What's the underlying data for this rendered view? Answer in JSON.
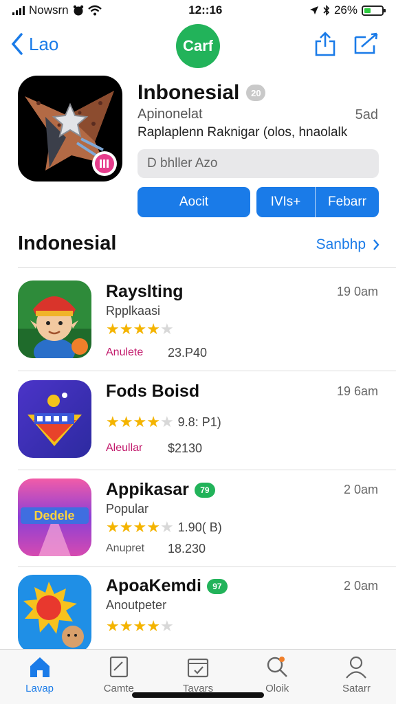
{
  "status_bar": {
    "carrier": "Nowsrn",
    "time": "12::16",
    "battery": "26%"
  },
  "nav": {
    "back_label": "Lao",
    "logo_text": "Carf"
  },
  "hero": {
    "title": "Inbonesial",
    "age_badge": "20",
    "subtitle": "Apinonelat",
    "size": "5ad",
    "description": "Raplaplenn Raknigar (olos, hnaolalk",
    "search_placeholder": "D bhller Azo",
    "primary_button": "Aocit",
    "split_button_1": "IVIs+",
    "split_button_2": "Febarr"
  },
  "section": {
    "title": "Indonesial",
    "see_all": "Sanbhp"
  },
  "apps": [
    {
      "name": "Rayslting",
      "verified": "",
      "category": "Rpplkaasi",
      "time": "19 0am",
      "stars": 4.5,
      "rating": "",
      "tag": "Anulete",
      "price": "23.P40"
    },
    {
      "name": "Fods Boisd",
      "verified": "",
      "category": "",
      "time": "19 6am",
      "stars": 4.5,
      "rating": "9.8: P1)",
      "tag": "Aleullar",
      "price": "$2130"
    },
    {
      "name": "Appikasar",
      "verified": "79",
      "category": "Popular",
      "time": "2 0am",
      "stars": 4.5,
      "rating": "1.90( B)",
      "tag": "Anupret",
      "price": "18.230"
    },
    {
      "name": "ApoaKemdi",
      "verified": "97",
      "category": "Anoutpeter",
      "time": "2 0am",
      "stars": 4,
      "rating": "",
      "tag": "",
      "price": ""
    }
  ],
  "tabs": [
    {
      "label": "Lavap",
      "active": true
    },
    {
      "label": "Camte"
    },
    {
      "label": "Tavars"
    },
    {
      "label": "Oloik"
    },
    {
      "label": "Satarr"
    }
  ],
  "colors": {
    "accent": "#1a7be8",
    "brand_green": "#22b35a",
    "star": "#f4b400"
  }
}
